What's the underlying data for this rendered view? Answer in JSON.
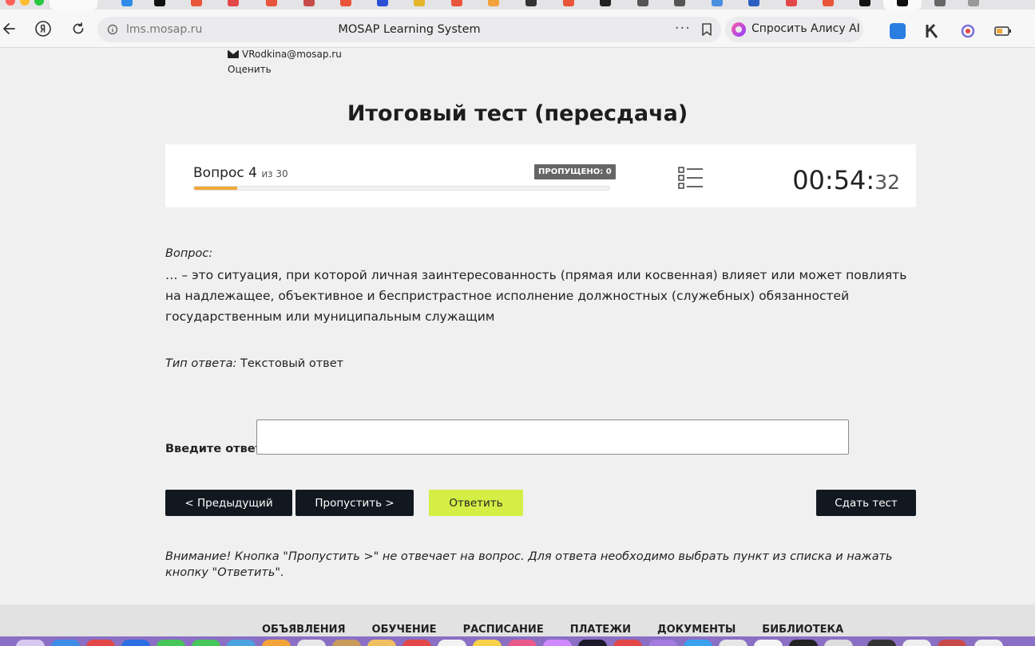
{
  "browser": {
    "url": "lms.mosap.ru",
    "page_title": "MOSAP Learning System",
    "menu_dots": "···",
    "alice_label": "Спросить Алису AI"
  },
  "header": {
    "email": "VRodkina@mosap.ru",
    "rate_link": "Оценить"
  },
  "test": {
    "title": "Итоговый тест (пересдача)",
    "question_label": "Вопрос 4",
    "question_of": "из 30",
    "question_current": 4,
    "question_total": 30,
    "progress_fraction": 0.103,
    "skipped_badge": "ПРОПУЩЕНО: 0",
    "timer_main": "00:54:",
    "timer_seconds": "32"
  },
  "question": {
    "caption": "Вопрос:",
    "text": "… – это ситуация, при которой личная заинтересованность (прямая или косвенная) влияет или может повлиять на надлежащее, объективное и беспристрастное исполнение должностных (служебных) обязанностей государственным или муниципальным служащим",
    "answer_type_label": "Тип ответа:",
    "answer_type_value": "Текстовый ответ"
  },
  "answer": {
    "label": "Введите ответ:",
    "value": ""
  },
  "buttons": {
    "prev": "< Предыдущий",
    "skip": "Пропустить >",
    "answer": "Ответить",
    "finish": "Сдать тест"
  },
  "warning": "Внимание! Кнопка \"Пропустить >\" не отвечает на вопрос. Для ответа необходимо выбрать пункт из списка и нажать кнопку \"Ответить\".",
  "footer_nav": [
    "ОБЪЯВЛЕНИЯ",
    "ОБУЧЕНИЕ",
    "РАСПИСАНИЕ",
    "ПЛАТЕЖИ",
    "ДОКУМЕНТЫ",
    "БИБЛИОТЕКА"
  ],
  "colors": {
    "progress_fill": "#f0a83a",
    "answer_button": "#d4ee45",
    "dark_button": "#12181f"
  }
}
